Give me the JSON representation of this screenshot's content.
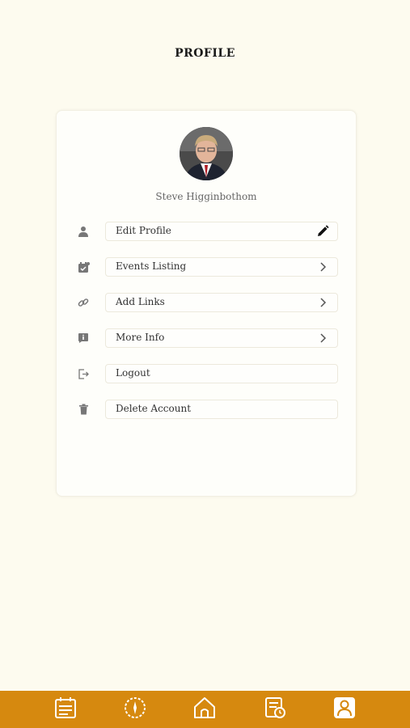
{
  "header": {
    "title": "PROFILE"
  },
  "profile": {
    "name": "Steve Higginbothom",
    "avatar_icon": "user-photo"
  },
  "menu": [
    {
      "label": "Edit Profile",
      "icon": "person-icon",
      "action_icon": "pencil-icon"
    },
    {
      "label": "Events Listing",
      "icon": "calendar-check-icon",
      "action_icon": "chevron-right-icon"
    },
    {
      "label": "Add Links",
      "icon": "link-icon",
      "action_icon": "chevron-right-icon"
    },
    {
      "label": "More Info",
      "icon": "info-icon",
      "action_icon": "chevron-right-icon"
    },
    {
      "label": "Logout",
      "icon": "logout-icon",
      "action_icon": ""
    },
    {
      "label": "Delete Account",
      "icon": "trash-icon",
      "action_icon": ""
    }
  ],
  "bottom_nav": [
    {
      "icon": "news-icon"
    },
    {
      "icon": "compass-icon"
    },
    {
      "icon": "home-icon"
    },
    {
      "icon": "schedule-icon"
    },
    {
      "icon": "profile-icon",
      "active": true
    }
  ],
  "colors": {
    "background": "#fdfbef",
    "nav_bar": "#d6890f",
    "card": "#fefefa"
  }
}
